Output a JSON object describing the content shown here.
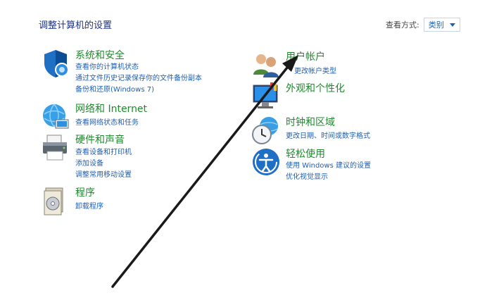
{
  "page": {
    "title": "调整计算机的设置"
  },
  "view": {
    "label": "查看方式:",
    "selected": "类别"
  },
  "left": [
    {
      "title": "系统和安全",
      "links": [
        "查看你的计算机状态",
        "通过文件历史记录保存你的文件备份副本",
        "备份和还原(Windows 7)"
      ],
      "icon": "shield-icon"
    },
    {
      "title": "网络和 Internet",
      "links": [
        "查看网络状态和任务"
      ],
      "icon": "network-globe-icon"
    },
    {
      "title": "硬件和声音",
      "links": [
        "查看设备和打印机",
        "添加设备",
        "调整常用移动设置"
      ],
      "icon": "printer-icon"
    },
    {
      "title": "程序",
      "links": [
        "卸载程序"
      ],
      "icon": "programs-disc-icon"
    }
  ],
  "right": [
    {
      "title": "用户帐户",
      "links": [
        "更改帐户类型"
      ],
      "icon": "users-icon"
    },
    {
      "title": "外观和个性化",
      "links": [],
      "icon": "monitor-paint-icon"
    },
    {
      "title": "时钟和区域",
      "links": [
        "更改日期、时间或数字格式"
      ],
      "icon": "clock-globe-icon"
    },
    {
      "title": "轻松使用",
      "links": [
        "使用 Windows 建议的设置",
        "优化视觉显示"
      ],
      "icon": "ease-of-access-icon"
    }
  ]
}
